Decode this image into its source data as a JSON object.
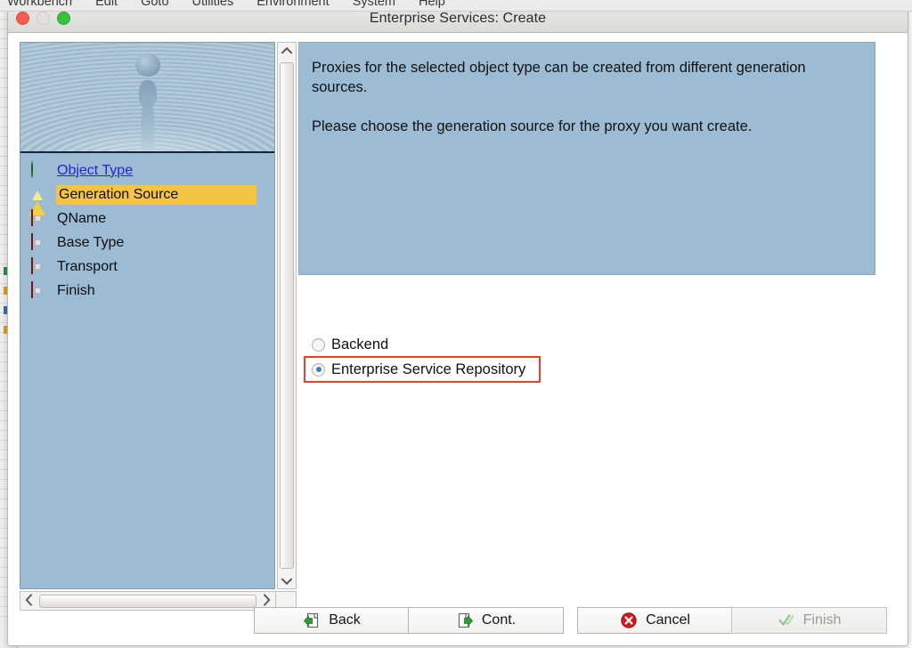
{
  "menubar": {
    "items": [
      "Workbench",
      "Edit",
      "Goto",
      "Utilities",
      "Environment",
      "System",
      "Help"
    ]
  },
  "window": {
    "title": "Enterprise Services: Create",
    "traffic_lights": {
      "close": "close-button",
      "minimize": "minimize-button",
      "maximize": "maximize-button"
    }
  },
  "sidebar": {
    "image_alt": "water-droplet-splash",
    "steps": [
      {
        "label": "Object Type",
        "icon": "green-circle-icon",
        "state": "completed",
        "is_link": true
      },
      {
        "label": "Generation Source",
        "icon": "yellow-triangle-icon",
        "state": "current",
        "is_link": false
      },
      {
        "label": "QName",
        "icon": "red-square-icon",
        "state": "pending",
        "is_link": false
      },
      {
        "label": "Base Type",
        "icon": "red-square-icon",
        "state": "pending",
        "is_link": false
      },
      {
        "label": "Transport",
        "icon": "red-square-icon",
        "state": "pending",
        "is_link": false
      },
      {
        "label": "Finish",
        "icon": "red-square-icon",
        "state": "pending",
        "is_link": false
      }
    ]
  },
  "main": {
    "info": {
      "paragraph1": "Proxies for the selected object type can be created from different generation sources.",
      "paragraph2": "Please choose the generation source for the proxy you want create."
    },
    "radio_group": {
      "name": "generation-source",
      "options": [
        {
          "label": "Backend",
          "selected": false,
          "highlighted": false
        },
        {
          "label": "Enterprise Service Repository",
          "selected": true,
          "highlighted": true
        }
      ]
    }
  },
  "footer": {
    "buttons": [
      {
        "label": "Back",
        "icon": "page-back-arrow-icon",
        "disabled": false
      },
      {
        "label": "Cont.",
        "icon": "page-forward-arrow-icon",
        "disabled": false
      },
      {
        "label": "Cancel",
        "icon": "red-x-circle-icon",
        "disabled": false
      },
      {
        "label": "Finish",
        "icon": "green-check-icon",
        "disabled": true
      }
    ]
  },
  "colors": {
    "panel_blue": "#9bbcd4",
    "current_step_amber": "#f5c444",
    "link_blue": "#2026d8",
    "highlight_red": "#e8412b",
    "titlebar_gray": "#e4e2df"
  }
}
